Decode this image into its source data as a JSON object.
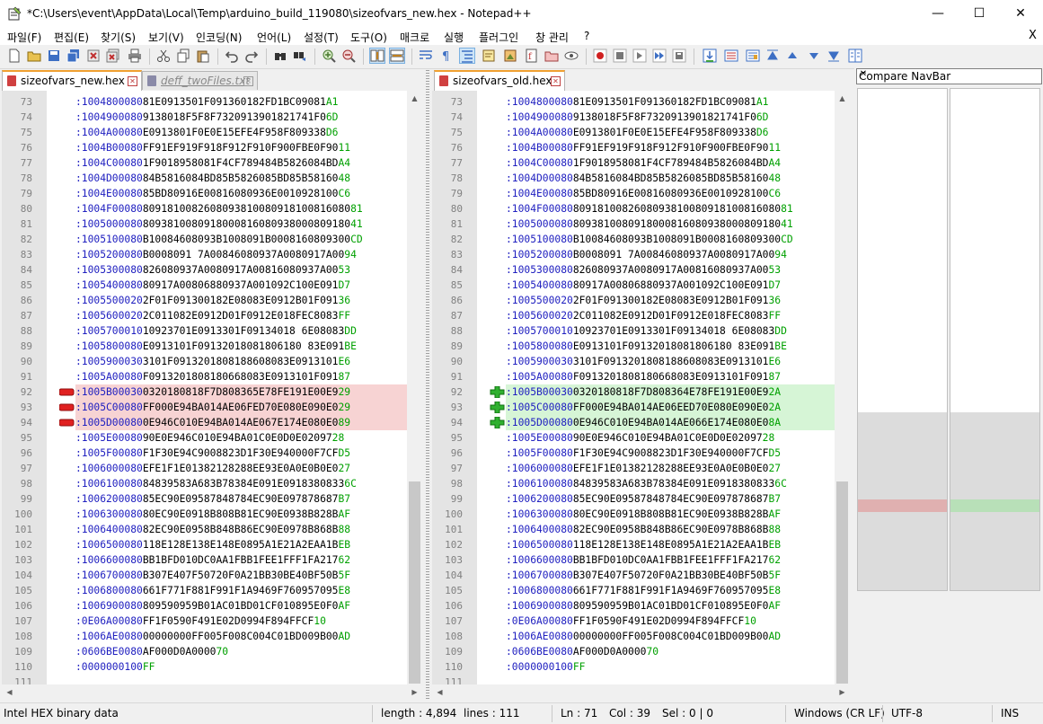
{
  "window": {
    "title": "*C:\\Users\\event\\AppData\\Local\\Temp\\arduino_build_119080\\sizeofvars_new.hex - Notepad++",
    "minimize_glyph": "—",
    "maximize_glyph": "☐",
    "close_glyph": "✕"
  },
  "menu": {
    "items": [
      "파일(F)",
      "편집(E)",
      "찾기(S)",
      "보기(V)",
      "인코딩(N)",
      "언어(L)",
      "설정(T)",
      "도구(O)",
      "매크로",
      "실행",
      "플러그인",
      "창 관리",
      "?"
    ],
    "close_label": "X"
  },
  "left_pane": {
    "tabs": [
      {
        "label": "sizeofvars_new.hex",
        "active": true
      },
      {
        "label": "deff_twoFiles.txt",
        "active": false
      }
    ]
  },
  "right_pane": {
    "tabs": [
      {
        "label": "sizeofvars_old.hex",
        "active": true
      }
    ]
  },
  "editor": {
    "first_line": 73,
    "rows": [
      {
        "n": "73",
        "l": ":1004800080",
        "ck": "A1",
        "b": "81E0913501F091360182FD1BC09081"
      },
      {
        "n": "74",
        "l": ":1004900080",
        "ck": "6D",
        "b": "9138018F5F8F7320913901821741F0"
      },
      {
        "n": "75",
        "l": ":1004A00080",
        "ck": "D6",
        "b": "E0913801F0E0E15EFE4F958F809338"
      },
      {
        "n": "76",
        "l": ":1004B00080",
        "ck": "11",
        "b": "FF91EF919F918F912F910F900FBE0F90"
      },
      {
        "n": "77",
        "l": ":1004C00080",
        "ck": "A4",
        "b": "1F9018958081F4CF789484B5826084BD"
      },
      {
        "n": "78",
        "l": ":1004D00080",
        "ck": "48",
        "b": "84B5816084BD85B5826085BD85B58160"
      },
      {
        "n": "79",
        "l": ":1004E00080",
        "ck": "C6",
        "b": "85BD80916E00816080936E0010928100"
      },
      {
        "n": "80",
        "l": ":1004F00080",
        "ck": "81",
        "b": "8091810082608093810080918100816080"
      },
      {
        "n": "81",
        "l": ":1005000080",
        "ck": "41",
        "b": "8093810080918000816080938000809180"
      },
      {
        "n": "82",
        "l": ":1005100080",
        "ck": "CD",
        "b": "B10084608093B1008091B0008160809300"
      },
      {
        "n": "83",
        "l": ":1005200080",
        "ck": "94",
        "b": "B0008091 7A00846080937A0080917A00"
      },
      {
        "n": "84",
        "l": ":1005300080",
        "ck": "53",
        "b": "826080937A0080917A00816080937A00"
      },
      {
        "n": "85",
        "l": ":1005400080",
        "ck": "D7",
        "b": "80917A00806880937A001092C100E091"
      },
      {
        "n": "86",
        "l": ":1005500020",
        "ck": "36",
        "b": "2F01F091300182E08083E0912B01F091"
      },
      {
        "n": "87",
        "l": ":1005600020",
        "ck": "FF",
        "b": "2C011082E0912D01F0912E018FEC8083"
      },
      {
        "n": "88",
        "l": ":1005700010",
        "ck": "DD",
        "b": "10923701E0913301F09134018 6E08083"
      },
      {
        "n": "89",
        "l": ":1005800080",
        "ck": "BE",
        "b": "E0913101F09132018081806180 83E091"
      },
      {
        "n": "90",
        "l": ":1005900030",
        "ck": "E6",
        "b": "3101F0913201808188608083E0913101"
      },
      {
        "n": "91",
        "l": ":1005A00080",
        "ck": "87",
        "b": "F0913201808180668083E0913101F091"
      },
      {
        "n": "92",
        "l": ":1005B00030",
        "ck": "29",
        "b": "0320180818F7D808365E78FE191E00E9",
        "diff": true
      },
      {
        "n": "93",
        "l": ":1005C00080",
        "ck": "29",
        "b": "FF000E94BA014AE06FED70E080E090E0",
        "diff": true
      },
      {
        "n": "94",
        "l": ":1005D00080",
        "ck": "89",
        "b": "0E946C010E94BA014AE067E174E080E0",
        "diff": true
      },
      {
        "n": "95",
        "l": ":1005E00080",
        "ck": "28",
        "b": "90E0E946C010E94BA01C0E0D0E02097"
      },
      {
        "n": "96",
        "l": ":1005F00080",
        "ck": "D5",
        "b": "F1F30E94C9008823D1F30E940000F7CF"
      },
      {
        "n": "97",
        "l": ":1006000080",
        "ck": "27",
        "b": "EFE1F1E01382128288EE93E0A0E0B0E0"
      },
      {
        "n": "98",
        "l": ":1006100080",
        "ck": "6C",
        "b": "84839583A683B78384E091E0918380833"
      },
      {
        "n": "99",
        "l": ":1006200080",
        "ck": "B7",
        "b": "85EC90E09587848784EC90E097878687"
      },
      {
        "n": "100",
        "l": ":1006300080",
        "ck": "AF",
        "b": "80EC90E0918B808B81EC90E0938B828B"
      },
      {
        "n": "101",
        "l": ":1006400080",
        "ck": "88",
        "b": "82EC90E0958B848B86EC90E0978B868B"
      },
      {
        "n": "102",
        "l": ":1006500080",
        "ck": "EB",
        "b": "118E128E138E148E0895A1E21A2EAA1B"
      },
      {
        "n": "103",
        "l": ":1006600080",
        "ck": "62",
        "b": "BB1BFD010DC0AA1FBB1FEE1FFF1FA217"
      },
      {
        "n": "104",
        "l": ":1006700080",
        "ck": "5F",
        "b": "B307E407F50720F0A21BB30BE40BF50B"
      },
      {
        "n": "105",
        "l": ":1006800080",
        "ck": "E8",
        "b": "661F771F881F991F1A9469F760957095"
      },
      {
        "n": "106",
        "l": ":1006900080",
        "ck": "AF",
        "b": "809590959B01AC01BD01CF010895E0F0"
      },
      {
        "n": "107",
        "l": ":0E06A00080",
        "ck": "10",
        "b": "FF1F0590F491E02D0994F894FFCF"
      },
      {
        "n": "108",
        "l": ":1006AE0080",
        "ck": "AD",
        "b": "00000000FF005F008C004C01BD009B00"
      },
      {
        "n": "109",
        "l": ":0606BE0080",
        "ck": "70",
        "b": "AF000D0A0000"
      },
      {
        "n": "110",
        "l": ":0000000100",
        "ck": "FF",
        "b": ""
      },
      {
        "n": "111",
        "l": "",
        "ck": "",
        "b": ""
      }
    ]
  },
  "navbar": {
    "title": "Compare NavBar",
    "close_glyph": "✕"
  },
  "status": {
    "file_type": "Intel HEX binary data",
    "length": "length : 4,894",
    "lines": "lines : 111",
    "ln": "Ln : 71",
    "col": "Col : 39",
    "sel": "Sel : 0 | 0",
    "eol": "Windows (CR LF)",
    "encoding": "UTF-8",
    "mode": "INS"
  },
  "colors": {
    "deleted_bg": "#f7d3d3",
    "added_bg": "#d6f5d6",
    "address": "#2020c0",
    "checksum": "#00a000"
  }
}
